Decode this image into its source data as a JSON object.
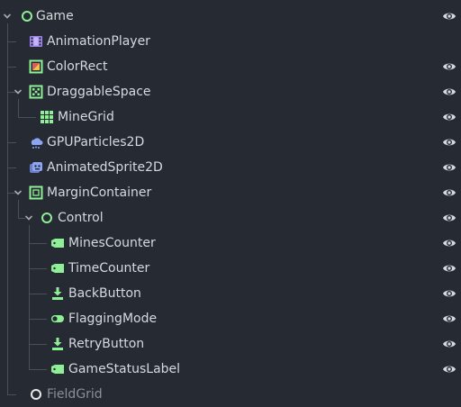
{
  "colors": {
    "background": "#262a32",
    "text": "#d6d9de",
    "muted_text": "#8a8f98",
    "node_green": "#8eef97",
    "node_purple": "#a286ef",
    "node_blue": "#8da5f3",
    "eye": "#d6d9de"
  },
  "tree": {
    "nodes": [
      {
        "label": "Game",
        "icon": "node-circle-icon",
        "expanded": true,
        "visible_eye": true
      },
      {
        "label": "AnimationPlayer",
        "icon": "animation-player-icon",
        "visible_eye": false
      },
      {
        "label": "ColorRect",
        "icon": "color-rect-icon",
        "visible_eye": true
      },
      {
        "label": "DraggableSpace",
        "icon": "draggable-space-icon",
        "expanded": true,
        "visible_eye": true
      },
      {
        "label": "MineGrid",
        "icon": "grid-container-icon",
        "visible_eye": true
      },
      {
        "label": "GPUParticles2D",
        "icon": "particles-icon",
        "visible_eye": true
      },
      {
        "label": "AnimatedSprite2D",
        "icon": "animated-sprite-icon",
        "visible_eye": true
      },
      {
        "label": "MarginContainer",
        "icon": "margin-container-icon",
        "expanded": true,
        "visible_eye": true
      },
      {
        "label": "Control",
        "icon": "control-circle-icon",
        "expanded": true,
        "visible_eye": true
      },
      {
        "label": "MinesCounter",
        "icon": "label-tag-icon",
        "visible_eye": true
      },
      {
        "label": "TimeCounter",
        "icon": "label-tag-icon",
        "visible_eye": true
      },
      {
        "label": "BackButton",
        "icon": "texture-button-icon",
        "visible_eye": true
      },
      {
        "label": "FlaggingMode",
        "icon": "check-toggle-icon",
        "visible_eye": true
      },
      {
        "label": "RetryButton",
        "icon": "texture-button-icon",
        "visible_eye": true
      },
      {
        "label": "GameStatusLabel",
        "icon": "label-tag-icon",
        "visible_eye": true
      },
      {
        "label": "FieldGrid",
        "icon": "node-circle-white-icon",
        "visible_eye": false,
        "dimmed": true
      }
    ]
  }
}
